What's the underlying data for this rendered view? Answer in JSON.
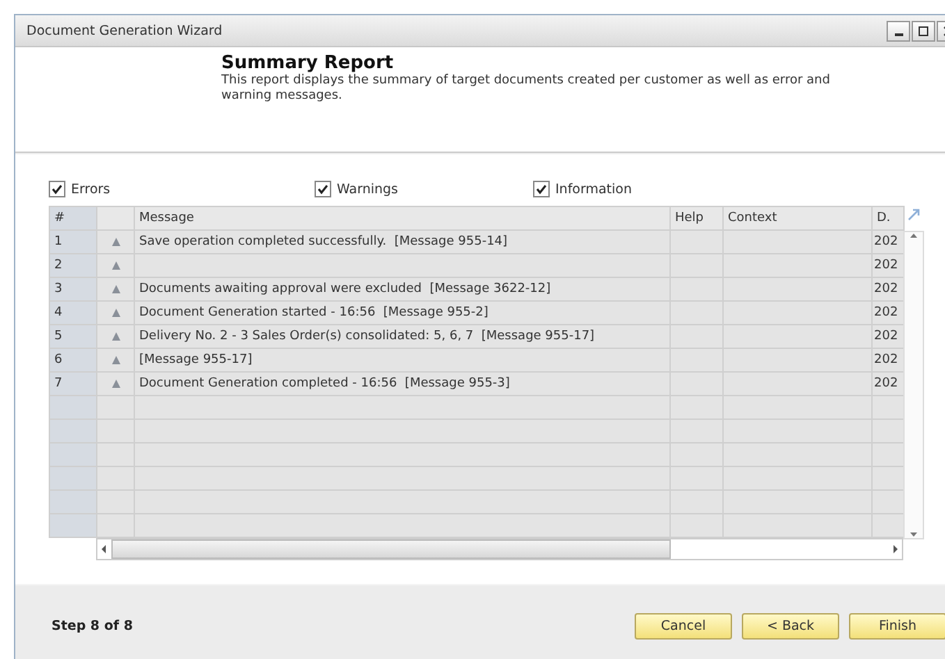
{
  "window": {
    "title": "Document Generation Wizard"
  },
  "header": {
    "title": "Summary Report",
    "description": "This report displays the summary of target documents created per customer as well as error and warning messages."
  },
  "filters": [
    {
      "label": "Errors",
      "checked": true
    },
    {
      "label": "Warnings",
      "checked": true
    },
    {
      "label": "Information",
      "checked": true
    }
  ],
  "table": {
    "columns": [
      "#",
      "Message",
      "Help",
      "Context",
      "D."
    ],
    "rows": [
      {
        "number": "1",
        "message": "Save operation completed successfully.  [Message 955-14]",
        "column_5": "202"
      },
      {
        "number": "2",
        "message": "",
        "column_5": "202"
      },
      {
        "number": "3",
        "message": "Documents awaiting approval were excluded  [Message 3622-12]",
        "column_5": "202"
      },
      {
        "number": "4",
        "message": "Document Generation started - 16:56  [Message 955-2]",
        "column_5": "202"
      },
      {
        "number": "5",
        "message": "Delivery No. 2 - 3 Sales Order(s) consolidated: 5, 6, 7  [Message 955-17]",
        "column_5": "202"
      },
      {
        "number": "6",
        "message": "[Message 955-17]",
        "column_5": "202"
      },
      {
        "number": "7",
        "message": "Document Generation completed - 16:56  [Message 955-3]",
        "column_5": "202"
      }
    ]
  },
  "footer": {
    "step": "Step 8 of 8",
    "buttons": [
      "Cancel",
      "< Back",
      "Finish"
    ]
  }
}
